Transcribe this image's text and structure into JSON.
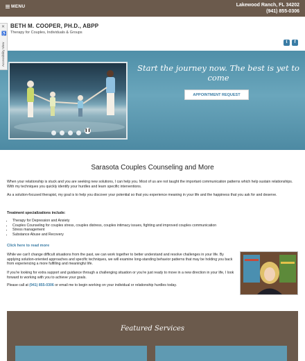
{
  "topbar": {
    "menu_label": "MENU",
    "location": "Lakewood Ranch, FL 34202",
    "phone": "(941) 855-0306"
  },
  "header": {
    "name": "BETH M. COOPER, PH.D., ABPP",
    "tagline": "Therapy for Couples, Individuals & Groups",
    "social": [
      "twitter-icon",
      "facebook-icon"
    ]
  },
  "accessibility": {
    "label": "Accessibility View"
  },
  "hero": {
    "title": "Start the journey now. The best is yet to come",
    "button": "APPOINTMENT REQUEST"
  },
  "main": {
    "title": "Sarasota Couples Counseling and More",
    "p1": "When your relationship is stuck and you are seeking new solutions, I can help you. Most of us are not taught the important communication patterns which help sustain relationships. With my techniques you quickly identify your hurdles and learn specific interventions.",
    "p2": "As a solution-focused therapist, my goal is to help you discover your potential so that you experience meaning in your  life and the happiness that you ask for and deserve.",
    "specs_heading": "Treatment specializations include:",
    "specs": [
      "Therapy for Depression and Anxiety",
      "Couples Counseling for couples stress, couples distress, couples intimacy issues, fighting and improved couples communication",
      "Stress management",
      "Substance Abuse and Recovery"
    ],
    "read_more": "Click here to read more",
    "p3": "While we can't change difficult situations from the past, we can work together to better understand and resolve challenges in your life. By applying solution-oriented approaches and specific techniques, we will examine long-standing behavior patterns that may be holding you back from experiencing a more fulfilling and meaningful life.",
    "p4": "If you're looking for extra support and guidance through a challenging situation or you're just ready to move in a new direction in your life, I look forward to working with you to achieve your goals.",
    "call_prefix": "Please call at ",
    "call_phone": "(941) 855-0306",
    "call_suffix": " or email me to begin working on your individual or relationship hurdles today."
  },
  "featured": {
    "title": "Featured Services"
  },
  "colors": {
    "brand_brown": "#6b5a4c",
    "hero_blue": "#5f9ab2",
    "link_blue": "#3a7ca5"
  }
}
